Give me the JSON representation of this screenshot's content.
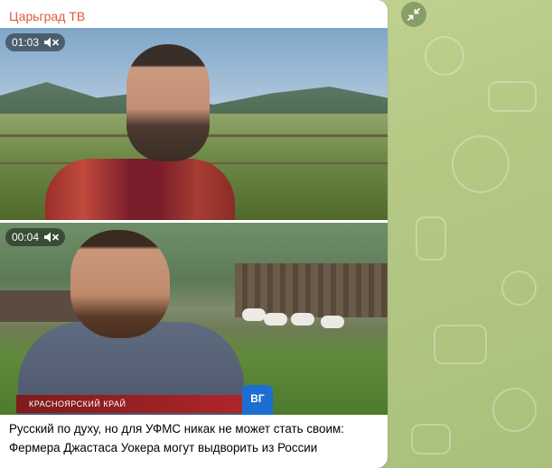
{
  "channel": {
    "name": "Царьград ТВ",
    "color": "#e0583a"
  },
  "videos": [
    {
      "duration": "01:03",
      "muted": true,
      "icon": "muted-speaker-icon"
    },
    {
      "duration": "00:04",
      "muted": true,
      "icon": "muted-speaker-icon",
      "overlay": {
        "location": "КРАСНОЯРСКИЙ КРАЙ",
        "mic_logo": "ВГ"
      }
    }
  ],
  "caption": {
    "line1": "Русский по духу, но для УФМС никак не может стать своим:",
    "line2": "Фермера Джастаса Уокера могут выдворить из России"
  },
  "controls": {
    "expand_icon": "collapse-arrows-icon"
  },
  "colors": {
    "bubble": "#ffffff",
    "wallpaper": "#b5c985"
  }
}
